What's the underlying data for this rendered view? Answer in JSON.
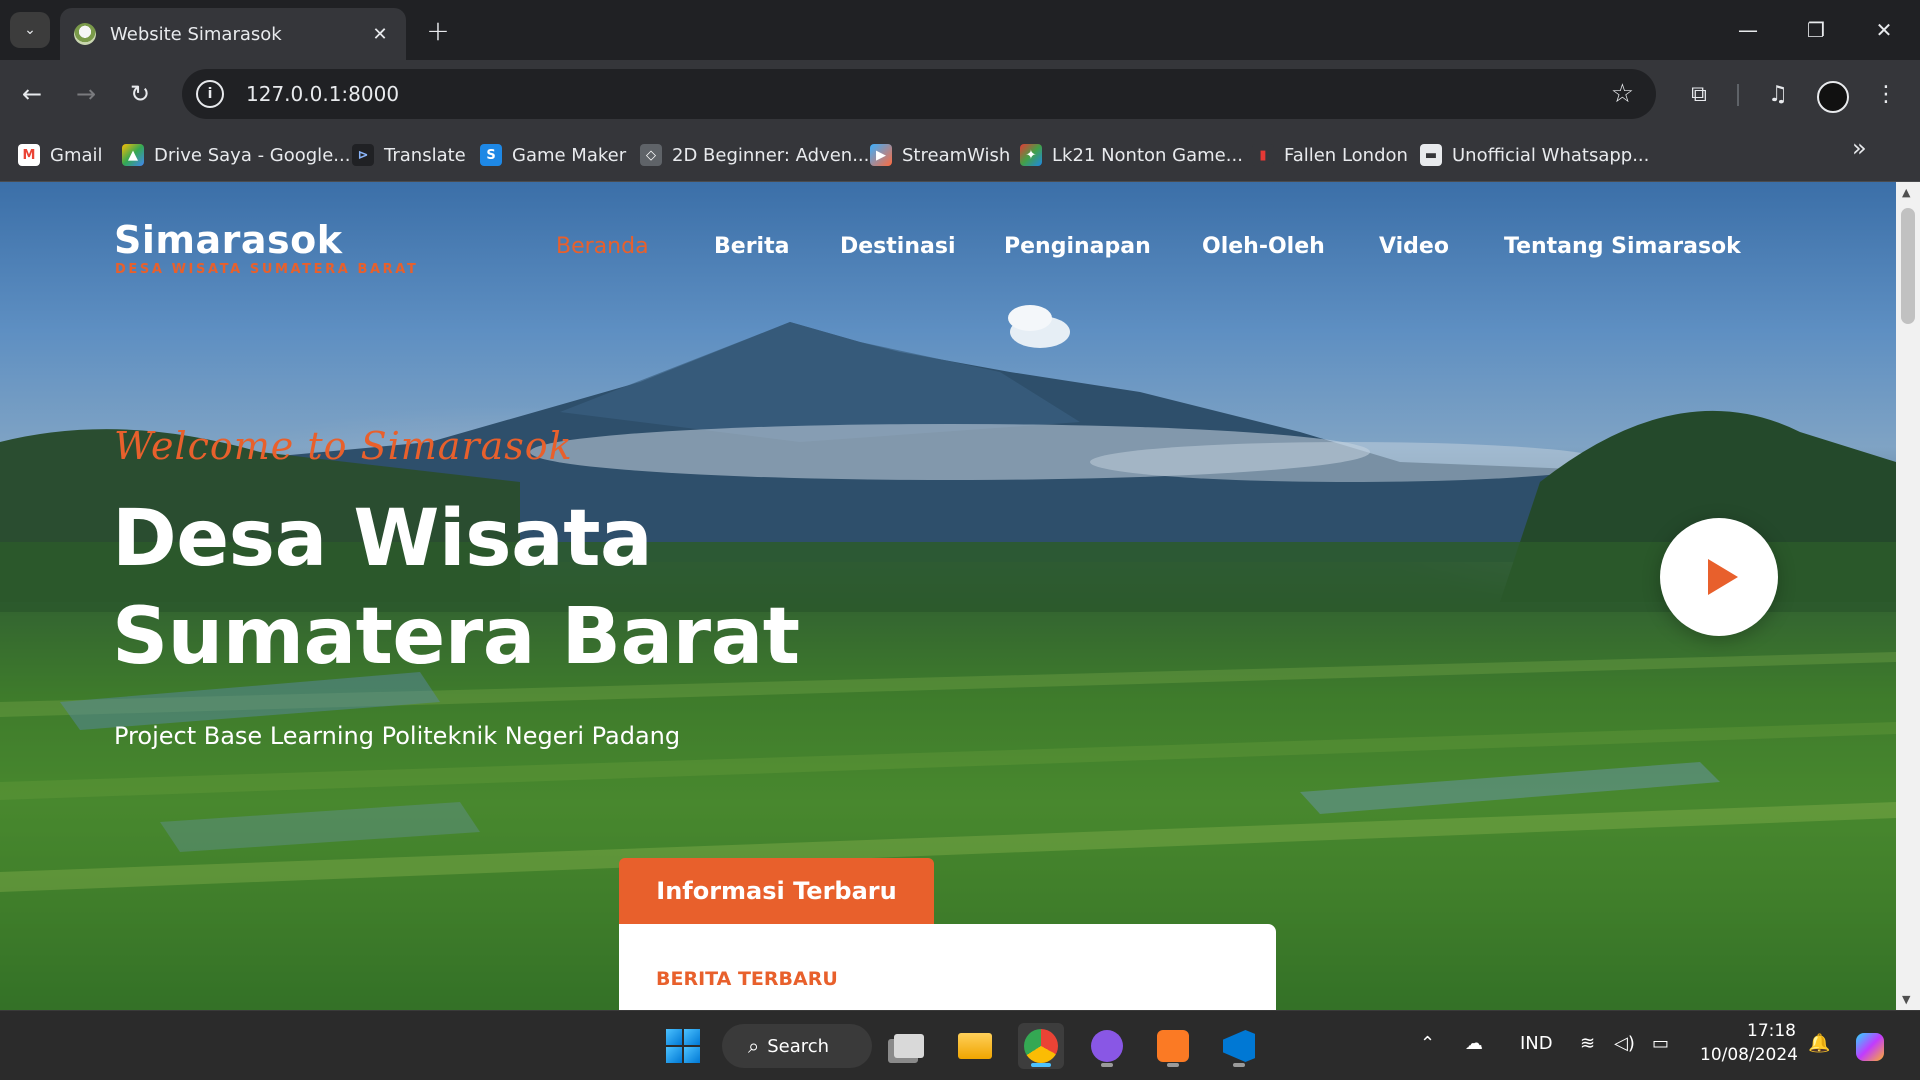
{
  "browser": {
    "tab_title": "Website Simarasok",
    "url": "127.0.0.1:8000",
    "bookmarks": [
      "Gmail",
      "Drive Saya - Google...",
      "Translate",
      "Game Maker",
      "2D Beginner: Adven...",
      "StreamWish",
      "Lk21 Nonton Game...",
      "Fallen London",
      "Unofficial Whatsapp..."
    ]
  },
  "site": {
    "logo_title": "Simarasok",
    "logo_subtitle": "DESA WISATA SUMATERA BARAT",
    "nav": [
      "Beranda",
      "Berita",
      "Destinasi",
      "Penginapan",
      "Oleh-Oleh",
      "Video",
      "Tentang Simarasok"
    ],
    "active_nav": "Beranda",
    "welcome": "Welcome to Simarasok",
    "hero_title_line1": "Desa Wisata",
    "hero_title_line2": "Sumatera Barat",
    "hero_subtitle": "Project Base Learning Politeknik Negeri Padang",
    "info_tab": "Informasi Terbaru",
    "info_heading": "BERITA TERBARU",
    "accent_color": "#e8602c"
  },
  "taskbar": {
    "search_label": "Search",
    "language": "IND",
    "time": "17:18",
    "date": "10/08/2024"
  }
}
